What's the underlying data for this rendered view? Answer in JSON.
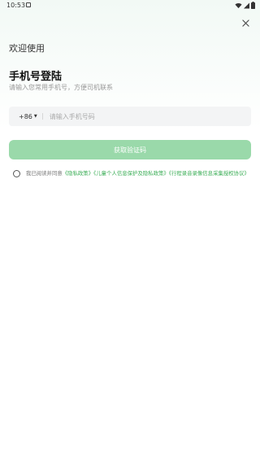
{
  "status_bar": {
    "time": "10:53",
    "icons": [
      "notification-icon",
      "wifi-icon",
      "signal-icon",
      "battery-icon"
    ]
  },
  "close_icon": "close-icon",
  "header": {
    "welcome": "欢迎使用",
    "title": "手机号登陆",
    "subtitle": "请输入您常用手机号，方便司机联系"
  },
  "phone": {
    "country_code": "+86",
    "placeholder": "请输入手机号码"
  },
  "get_code_button": "获取验证码",
  "agreement": {
    "prefix": "我已阅读并同意",
    "privacy": "《隐私政策》",
    "children_privacy": "《儿童个人信息保护及隐私政策》",
    "trip_recording": "《行程录音录像信息采集授权协议》"
  },
  "colors": {
    "accent_green": "#3cae57",
    "button_green": "#9ad9aa",
    "input_bg": "#f3f4f5"
  }
}
